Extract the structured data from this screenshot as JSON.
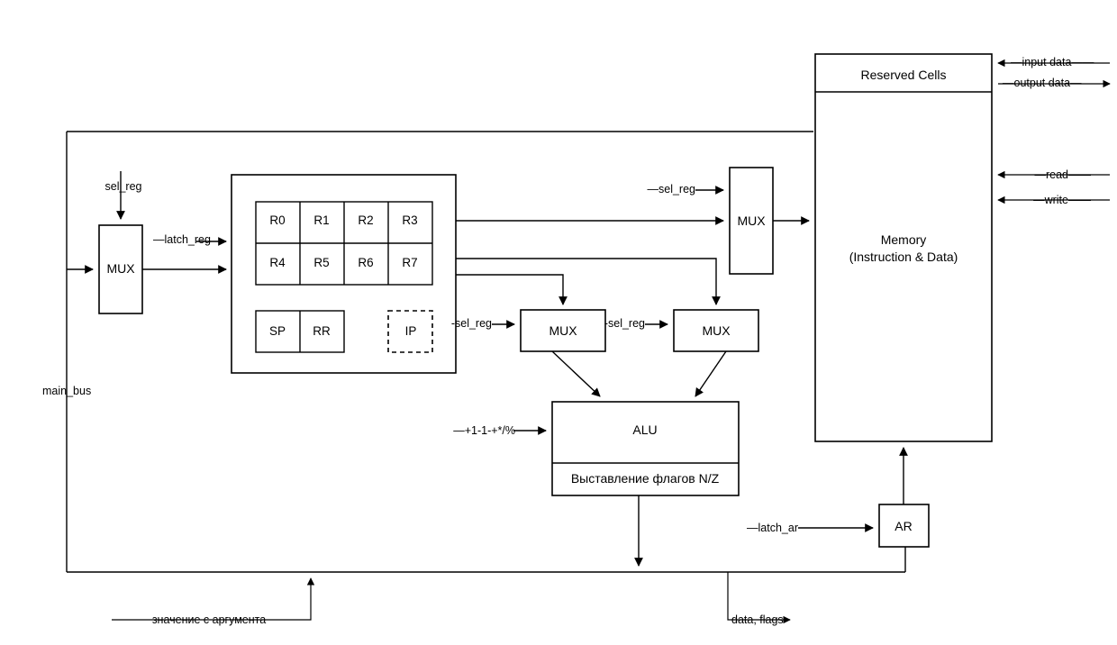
{
  "diagram": {
    "title": "CPU datapath block diagram",
    "stroke_color": "#000000",
    "background_color": "#ffffff"
  },
  "blocks": {
    "mux_left": {
      "label": "MUX"
    },
    "register_file": {
      "general_registers": [
        "R0",
        "R1",
        "R2",
        "R3",
        "R4",
        "R5",
        "R6",
        "R7"
      ],
      "special_registers": [
        "SP",
        "RR"
      ],
      "instruction_pointer": "IP"
    },
    "mux_mem": {
      "label": "MUX"
    },
    "mux_alu_left": {
      "label": "MUX"
    },
    "mux_alu_right": {
      "label": "MUX"
    },
    "alu": {
      "label": "ALU",
      "flags_label": "Выставление флагов N/Z"
    },
    "address_register": {
      "label": "AR"
    },
    "memory": {
      "reserved_label": "Reserved Cells",
      "main_label_line1": "Memory",
      "main_label_line2": "(Instruction & Data)"
    }
  },
  "signals": {
    "sel_reg_mux_left": "sel_reg",
    "latch_reg": "—latch_reg",
    "sel_reg_mem": "—sel_reg",
    "sel_reg_alu_left": "-sel_reg",
    "sel_reg_alu_right": "-sel_reg",
    "alu_ops": "—+1-1-+*/%",
    "latch_ar": "—latch_ar",
    "main_bus": "main_bus",
    "argument_value": "значение с аргумента",
    "data_flags": "data, flags",
    "input_data": "—input data——",
    "output_data": "—output data—",
    "read": "—read——",
    "write": "—write——"
  }
}
